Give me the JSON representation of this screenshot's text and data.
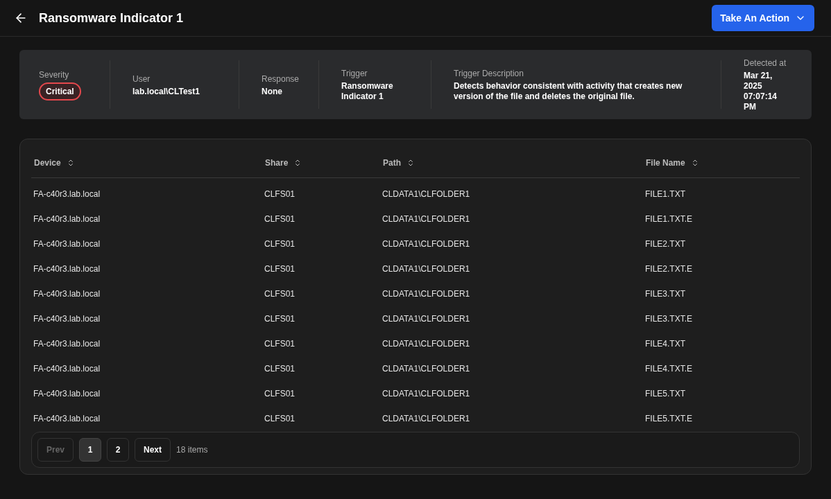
{
  "header": {
    "title": "Ransomware Indicator 1",
    "action_button": "Take An Action"
  },
  "summary": [
    {
      "label": "Severity",
      "value": "Critical",
      "kind": "badge"
    },
    {
      "label": "User",
      "value": "lab.local\\CLTest1",
      "kind": "text"
    },
    {
      "label": "Response",
      "value": "None",
      "kind": "text"
    },
    {
      "label": "Trigger",
      "value": "Ransomware Indicator 1",
      "kind": "text"
    },
    {
      "label": "Trigger Description",
      "value": "Detects behavior consistent with activity that creates new version of the file and deletes the original file.",
      "kind": "text"
    },
    {
      "label": "Detected at",
      "value": "Mar 21, 2025 07:07:14 PM",
      "kind": "text"
    }
  ],
  "table": {
    "columns": [
      "Device",
      "Share",
      "Path",
      "File Name"
    ],
    "rows": [
      [
        "FA-c40r3.lab.local",
        "CLFS01",
        "CLDATA1\\CLFOLDER1",
        "FILE1.TXT"
      ],
      [
        "FA-c40r3.lab.local",
        "CLFS01",
        "CLDATA1\\CLFOLDER1",
        "FILE1.TXT.E"
      ],
      [
        "FA-c40r3.lab.local",
        "CLFS01",
        "CLDATA1\\CLFOLDER1",
        "FILE2.TXT"
      ],
      [
        "FA-c40r3.lab.local",
        "CLFS01",
        "CLDATA1\\CLFOLDER1",
        "FILE2.TXT.E"
      ],
      [
        "FA-c40r3.lab.local",
        "CLFS01",
        "CLDATA1\\CLFOLDER1",
        "FILE3.TXT"
      ],
      [
        "FA-c40r3.lab.local",
        "CLFS01",
        "CLDATA1\\CLFOLDER1",
        "FILE3.TXT.E"
      ],
      [
        "FA-c40r3.lab.local",
        "CLFS01",
        "CLDATA1\\CLFOLDER1",
        "FILE4.TXT"
      ],
      [
        "FA-c40r3.lab.local",
        "CLFS01",
        "CLDATA1\\CLFOLDER1",
        "FILE4.TXT.E"
      ],
      [
        "FA-c40r3.lab.local",
        "CLFS01",
        "CLDATA1\\CLFOLDER1",
        "FILE5.TXT"
      ],
      [
        "FA-c40r3.lab.local",
        "CLFS01",
        "CLDATA1\\CLFOLDER1",
        "FILE5.TXT.E"
      ]
    ]
  },
  "pagination": {
    "prev": {
      "label": "Prev",
      "disabled": true
    },
    "pages": [
      {
        "label": "1",
        "selected": true
      },
      {
        "label": "2",
        "selected": false
      }
    ],
    "next": {
      "label": "Next",
      "disabled": false
    },
    "count": "18 items"
  }
}
